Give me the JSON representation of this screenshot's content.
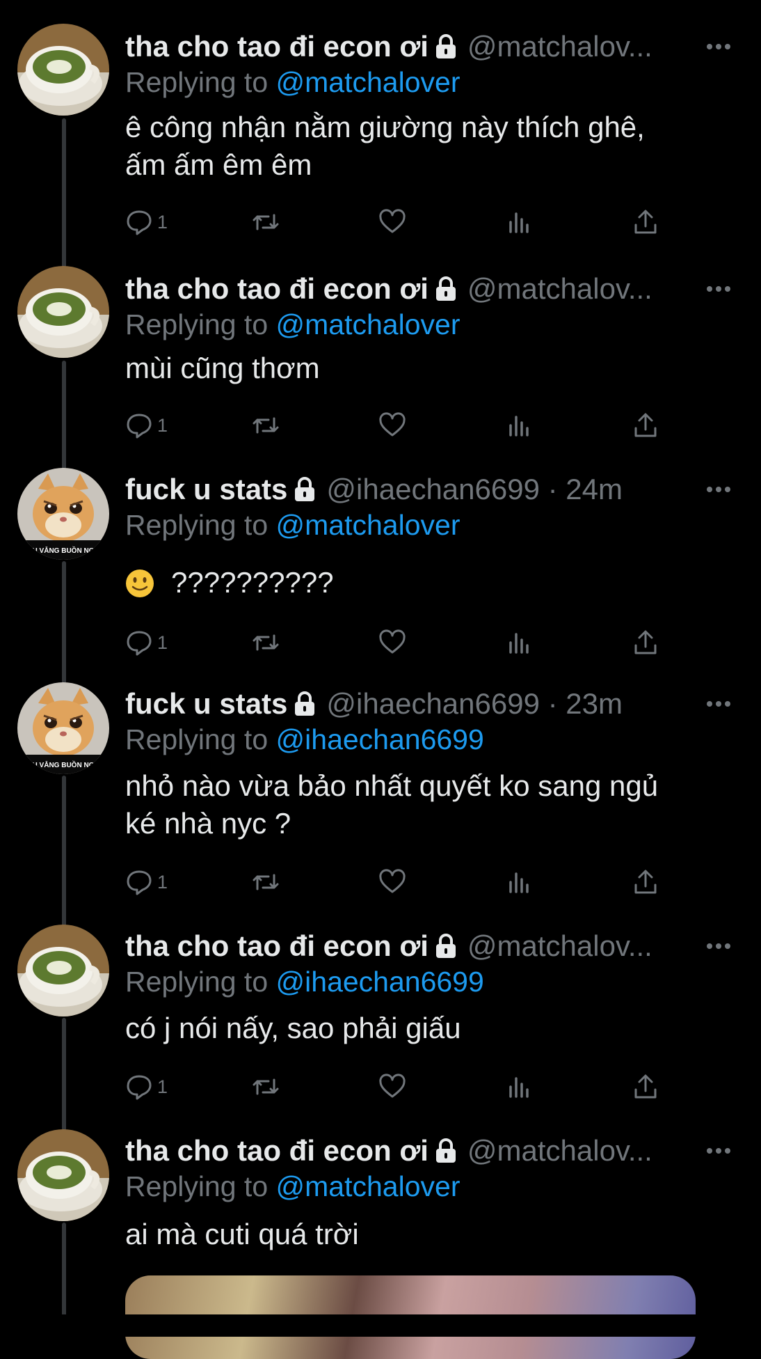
{
  "tweets": [
    {
      "name": "tha cho tao đi econ ơi",
      "handle": "@matchalov...",
      "replying_prefix": "Replying to",
      "replying_to": "@matchalover",
      "text_lines": [
        "ê công nhận nằm giường này thích ghê,",
        "ấm ấm êm êm"
      ],
      "reply_count": "1",
      "avatar": "matcha-latte-avatar"
    },
    {
      "name": "tha cho tao đi econ ơi",
      "handle": "@matchalov...",
      "replying_prefix": "Replying to",
      "replying_to": "@matchalover",
      "text_lines": [
        "mùi cũng thơm"
      ],
      "reply_count": "1",
      "avatar": "matcha-latte-avatar"
    },
    {
      "name": "fuck u stats",
      "handle": "@ihaechan6699 · 24m",
      "replying_prefix": "Replying to",
      "replying_to": "@matchalover",
      "text_lines": [
        "??????????"
      ],
      "emoji": "slightly-smiling-face",
      "reply_count": "1",
      "avatar": "cat-avatar",
      "avatar_caption": "AU VẴNG BUỒN NGỦ"
    },
    {
      "name": "fuck u stats",
      "handle": "@ihaechan6699 · 23m",
      "replying_prefix": "Replying to",
      "replying_to": "@ihaechan6699",
      "text_lines": [
        "nhỏ nào vừa bảo nhất quyết ko sang ngủ",
        "ké nhà nyc ?"
      ],
      "reply_count": "1",
      "avatar": "cat-avatar",
      "avatar_caption": "AU VẴNG BUỒN NGỦ"
    },
    {
      "name": "tha cho tao đi econ ơi",
      "handle": "@matchalov...",
      "replying_prefix": "Replying to",
      "replying_to": "@ihaechan6699",
      "text_lines": [
        "có j nói nấy, sao phải giấu"
      ],
      "reply_count": "1",
      "avatar": "matcha-latte-avatar"
    },
    {
      "name": "tha cho tao đi econ ơi",
      "handle": "@matchalov...",
      "replying_prefix": "Replying to",
      "replying_to": "@matchalover",
      "text_lines": [
        "ai mà cuti quá trời"
      ],
      "avatar": "matcha-latte-avatar",
      "has_media": true
    }
  ],
  "icons": {
    "reply": "reply-icon",
    "retweet": "retweet-icon",
    "like": "heart-icon",
    "views": "views-icon",
    "share": "share-icon",
    "more": "more-icon",
    "lock": "lock-icon"
  },
  "colors": {
    "background": "#000000",
    "text": "#e7e9ea",
    "secondary": "#71767b",
    "link": "#1d9bf0",
    "rail": "#333639"
  }
}
